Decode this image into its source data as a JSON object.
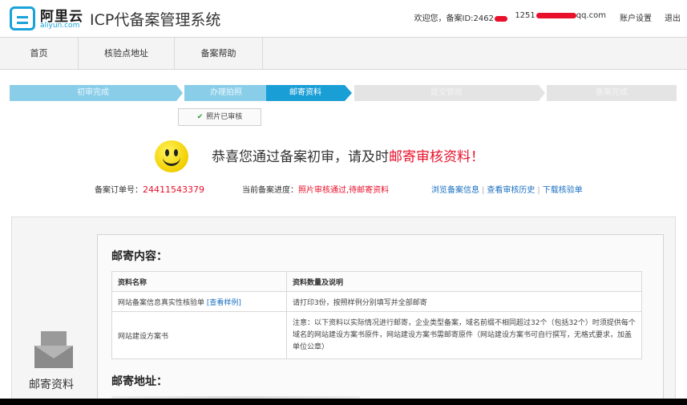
{
  "header": {
    "brand_cn": "阿里云",
    "brand_en": "aliyun.com",
    "system_title": "ICP代备案管理系统",
    "welcome": "欢迎您，备案ID:2462",
    "account": "1251",
    "account_suffix": "qq.com",
    "settings": "账户设置",
    "logout": "退出"
  },
  "nav": {
    "items": [
      {
        "label": "首页"
      },
      {
        "label": "核验点地址"
      },
      {
        "label": "备案帮助"
      }
    ]
  },
  "steps": [
    {
      "label": "初审完成",
      "state": "done"
    },
    {
      "label": "办理拍照",
      "state": "done"
    },
    {
      "label": "邮寄资料",
      "state": "current"
    },
    {
      "label": "提交管局",
      "state": "todo"
    },
    {
      "label": "备案完成",
      "state": "todo"
    }
  ],
  "photo_badge": "照片已审核",
  "congrats": {
    "text": "恭喜您通过备案初审，请及时",
    "highlight": "邮寄审核资料！"
  },
  "order": {
    "label": "备案订单号：",
    "number": "24411543379",
    "progress_label": "当前备案进度：",
    "progress_value": "照片审核通过,待邮寄资料",
    "links": [
      "浏览备案信息",
      "查看审核历史",
      "下载核验单"
    ]
  },
  "mail_icon_label": "邮寄资料",
  "mail_content": {
    "title": "邮寄内容：",
    "headers": [
      "资料名称",
      "资料数量及说明"
    ],
    "rows": [
      {
        "name": "网站备案信息真实性核验单",
        "link": "[查看样例]",
        "desc": "请打印3份，按照样例分别填写并全部邮寄"
      },
      {
        "name": "网站建设方案书",
        "link": "",
        "desc": "注意：以下资料以实际情况进行邮寄，企业类型备案，域名前缀不相同超过32个（包括32个）时须提供每个域名的网站建设方案书原件，网站建设方案书需邮寄原件（网站建设方案书可自行撰写，无格式要求，加盖单位公章）"
      }
    ]
  },
  "mail_address": {
    "title": "邮寄地址："
  },
  "colors": {
    "accent": "#1a9ed6",
    "step_done": "#89cde9",
    "step_todo": "#e4e4e4",
    "highlight_red": "#e8102a",
    "link_blue": "#1a6fc1"
  }
}
